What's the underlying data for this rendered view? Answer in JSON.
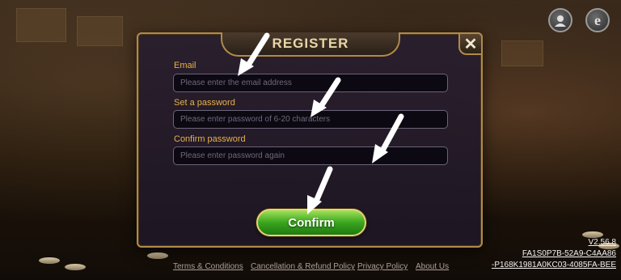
{
  "dialog": {
    "title": "REGISTER",
    "close_label": "✕",
    "email": {
      "label": "Email",
      "placeholder": "Please enter the email address"
    },
    "password": {
      "label": "Set a password",
      "placeholder": "Please enter password of 6-20 characters"
    },
    "confirm_password": {
      "label": "Confirm password",
      "placeholder": "Please enter password again"
    },
    "confirm_label": "Confirm"
  },
  "footer": {
    "links": [
      "Terms & Conditions",
      "Cancellation & Refund Policy",
      "Privacy Policy",
      "About Us"
    ]
  },
  "version": {
    "number": "V2.56.8",
    "id_line1": "FA1S0P7B-52A9-C4AA86",
    "id_line2": "-P168K1981A0KC03-4085FA-BEE"
  },
  "top_icons": [
    "customer-service-icon",
    "browser-e-icon"
  ],
  "colors": {
    "accent_gold": "#b08a4a",
    "label_orange": "#e8b24a",
    "confirm_green": "#3aa51e",
    "arrow": "#ffffff"
  }
}
